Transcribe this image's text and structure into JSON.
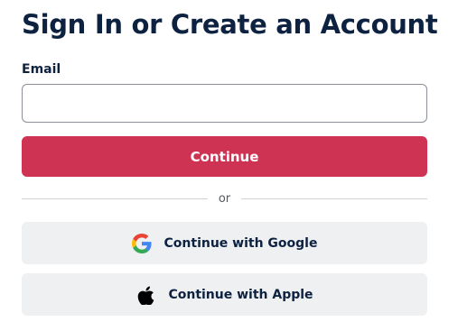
{
  "header": {
    "title": "Sign In or Create an Account"
  },
  "form": {
    "email_label": "Email",
    "email_value": "",
    "email_placeholder": "",
    "continue_label": "Continue",
    "divider_text": "or"
  },
  "social": {
    "google_label": "Continue with Google",
    "google_icon": "google-icon",
    "apple_label": "Continue with Apple",
    "apple_icon": "apple-icon"
  },
  "colors": {
    "primary_button": "#cf3354",
    "heading_text": "#0d2240",
    "social_button_bg": "#eff0f2"
  }
}
